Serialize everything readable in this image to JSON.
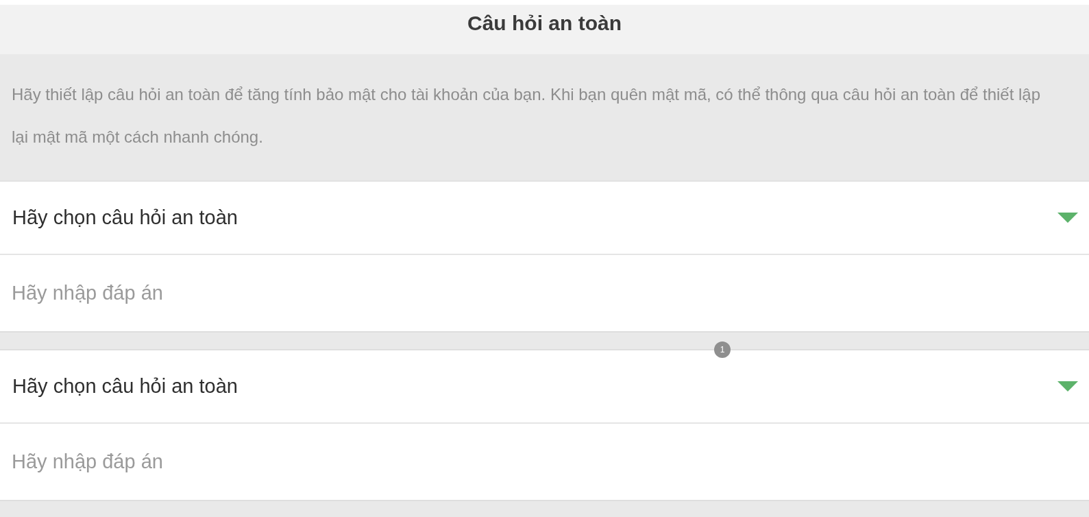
{
  "header": {
    "title": "Câu hỏi an toàn"
  },
  "intro": "Hãy thiết lập câu hỏi an toàn để tăng tính bảo mật cho tài khoản của bạn. Khi bạn quên mật mã, có thể thông qua câu hỏi an toàn để thiết lập lại mật mã một cách nhanh chóng.",
  "questions": [
    {
      "select_label": "Hãy chọn câu hỏi an toàn",
      "answer": {
        "placeholder": "Hãy nhập đáp án"
      }
    },
    {
      "select_label": "Hãy chọn câu hỏi an toàn",
      "answer": {
        "placeholder": "Hãy nhập đáp án"
      }
    }
  ],
  "badge": "1"
}
